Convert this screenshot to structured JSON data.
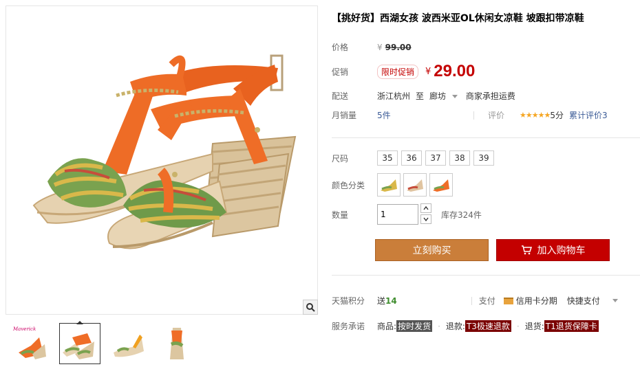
{
  "product": {
    "title": "【挑好货】西湖女孩 波西米亚OL休闲女凉鞋 坡跟扣带凉鞋"
  },
  "price": {
    "label": "价格",
    "currency": "¥",
    "original": "99.00"
  },
  "promo": {
    "label": "促销",
    "badge": "限时促销",
    "currency": "¥",
    "price": "29.00"
  },
  "delivery": {
    "label": "配送",
    "from": "浙江杭州",
    "to_word": "至",
    "to": "廊坊",
    "note": "商家承担运费"
  },
  "sales": {
    "label": "月销量",
    "value": "5件",
    "rating_label": "评价",
    "stars": "★★★★★",
    "score": "5分",
    "total_reviews": "累计评价3"
  },
  "sizes": {
    "label": "尺码",
    "options": [
      "35",
      "36",
      "37",
      "38",
      "39"
    ]
  },
  "colors": {
    "label": "颜色分类"
  },
  "quantity": {
    "label": "数量",
    "value": "1",
    "stock": "库存324件"
  },
  "actions": {
    "buy_now": "立刻购买",
    "add_to_cart": "加入购物车"
  },
  "points": {
    "label": "天猫积分",
    "value_prefix": "送",
    "value": "14",
    "pay_label": "支付",
    "installment": "信用卡分期",
    "quick_pay": "快捷支付"
  },
  "service": {
    "label": "服务承诺",
    "goods_label": "商品:",
    "goods_tag": "按时发货",
    "refund_label": "退款:",
    "refund_tag": "T3极速退款",
    "return_label": "退货:",
    "return_tag": "T1退货保障卡"
  },
  "thumbnails": {
    "brand_mark": "Maverick"
  },
  "colors_palette": {
    "price_red": "#c40000",
    "buy_button": "#ca7e3a",
    "cart_button": "#c40000"
  }
}
